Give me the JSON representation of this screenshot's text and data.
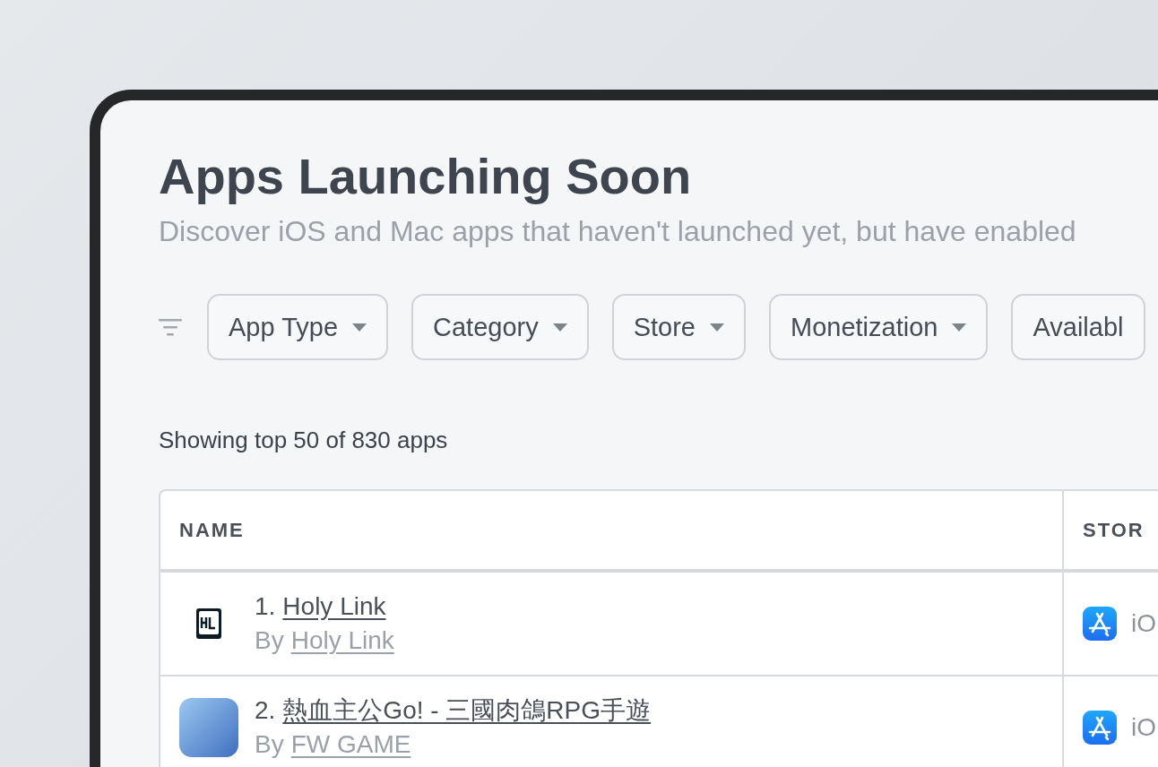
{
  "header": {
    "title": "Apps Launching Soon",
    "subtitle": "Discover iOS and Mac apps that haven't launched yet, but have enabled"
  },
  "filters": [
    {
      "label": "App Type",
      "caret": true
    },
    {
      "label": "Category",
      "caret": true
    },
    {
      "label": "Store",
      "caret": true
    },
    {
      "label": "Monetization",
      "caret": true
    },
    {
      "label": "Availabl",
      "caret": false
    }
  ],
  "summary": "Showing top 50 of 830 apps",
  "table": {
    "columns": [
      "NAME",
      "STOR"
    ],
    "rows": [
      {
        "rank": "1.",
        "name": "Holy Link",
        "by": "By",
        "developer": "Holy Link",
        "store": "iO"
      },
      {
        "rank": "2.",
        "name": "熱血主公Go! - 三國肉鴿RPG手遊",
        "by": "By",
        "developer": "FW GAME",
        "store": "iO"
      }
    ]
  }
}
